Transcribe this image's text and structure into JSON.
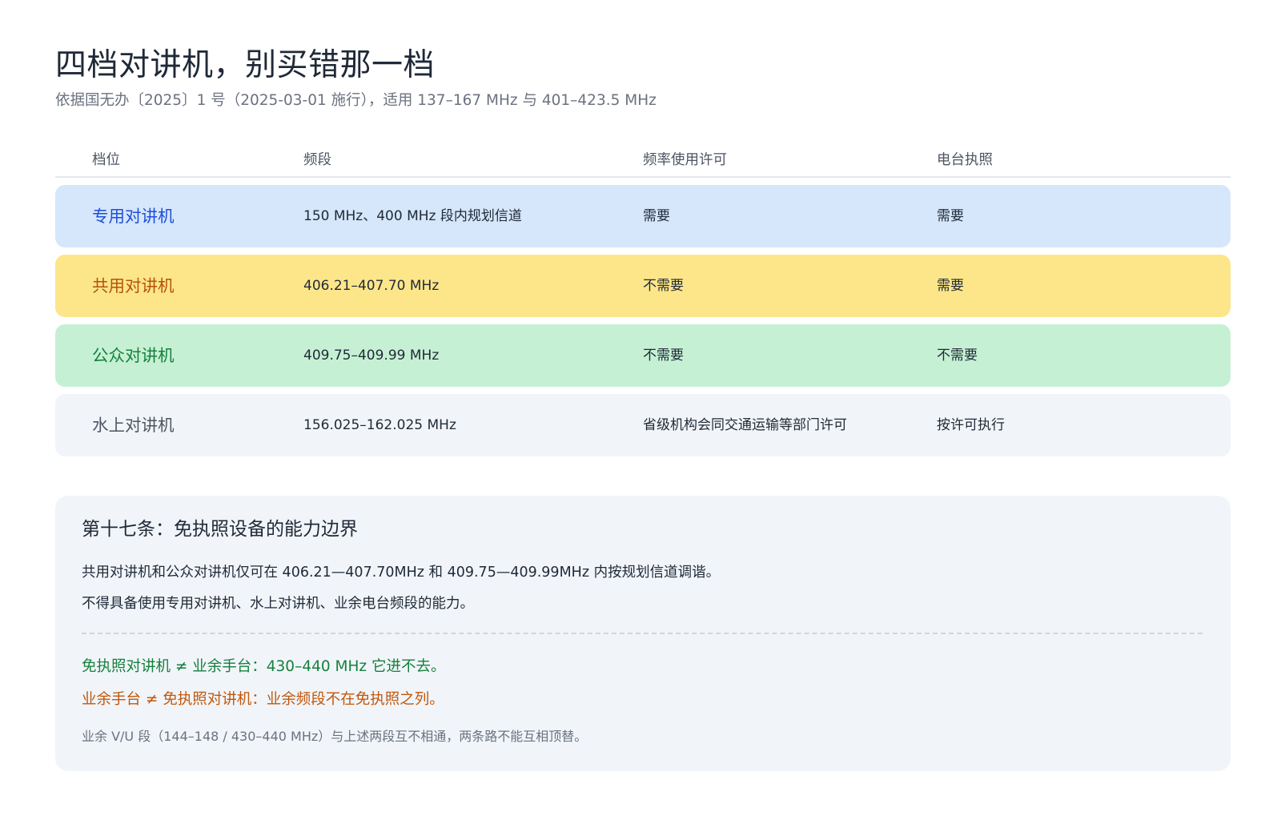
{
  "header": {
    "title": "四档对讲机，别买错那一档",
    "subtitle": "依据国无办〔2025〕1 号（2025-03-01 施行），适用 137–167 MHz 与 401–423.5 MHz"
  },
  "table": {
    "columns": [
      "档位",
      "频段",
      "频率使用许可",
      "电台执照"
    ],
    "rows": [
      {
        "name": "专用对讲机",
        "band": "150 MHz、400 MHz 段内规划信道",
        "freq_permit": "需要",
        "license": "需要"
      },
      {
        "name": "共用对讲机",
        "band": "406.21–407.70 MHz",
        "freq_permit": "不需要",
        "license": "需要"
      },
      {
        "name": "公众对讲机",
        "band": "409.75–409.99 MHz",
        "freq_permit": "不需要",
        "license": "不需要"
      },
      {
        "name": "水上对讲机",
        "band": "156.025–162.025 MHz",
        "freq_permit": "省级机构会同交通运输等部门许可",
        "license": "按许可执行"
      }
    ]
  },
  "note": {
    "title": "第十七条：免执照设备的能力边界",
    "line1": "共用对讲机和公众对讲机仅可在 406.21—407.70MHz 和 409.75—409.99MHz 内按规划信道调谐。",
    "line2": "不得具备使用专用对讲机、水上对讲机、业余电台频段的能力。",
    "green_line": "免执照对讲机 ≠ 业余手台：430–440 MHz 它进不去。",
    "orange_line": "业余手台 ≠ 免执照对讲机：业余频段不在免执照之列。",
    "footnote": "业余 V/U 段（144–148 / 430–440 MHz）与上述两段互不相通，两条路不能互相顶替。"
  },
  "colors": {
    "row_bg": [
      "#d6e6fb",
      "#fde68a",
      "#c6f0d4",
      "#f1f5f9"
    ],
    "row_name": [
      "#1d4ed8",
      "#b45309",
      "#15803d",
      "#4b5563"
    ],
    "accent_green": "#15803d",
    "accent_orange": "#c2570c"
  }
}
